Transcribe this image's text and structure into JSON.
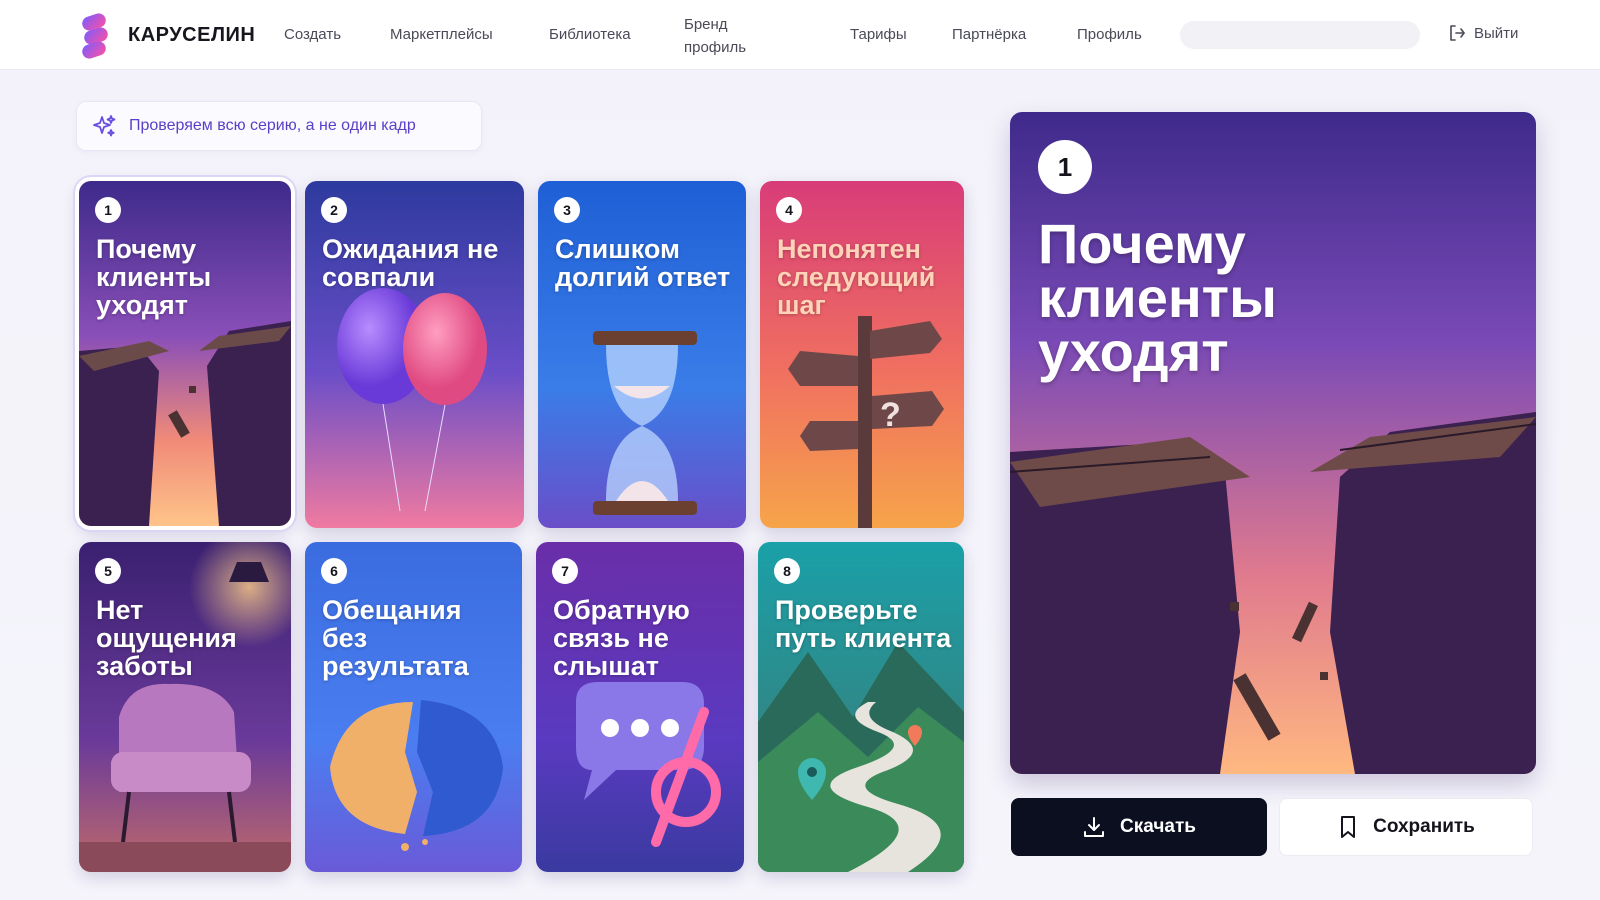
{
  "header": {
    "brand": "КАРУСЕЛИН",
    "nav": {
      "create": "Создать",
      "marketplaces": "Маркетплейсы",
      "library": "Библиотека",
      "brand_profile": "Бренд профиль",
      "tariffs": "Тарифы",
      "partner": "Партнёрка",
      "profile": "Профиль"
    },
    "search_value": "",
    "logout": "Выйти"
  },
  "pill": {
    "text": "Проверяем всю серию, а не один кадр",
    "icon": "sparkles-icon"
  },
  "cards": [
    {
      "number": "1",
      "title": "Почему клиенты уходят",
      "selected": true,
      "theme": "broken-bridge"
    },
    {
      "number": "2",
      "title": "Ожидания не совпали",
      "selected": false,
      "theme": "split-balloon"
    },
    {
      "number": "3",
      "title": "Слишком долгий ответ",
      "selected": false,
      "theme": "hourglass"
    },
    {
      "number": "4",
      "title": "Непонятен следующий шаг",
      "selected": false,
      "theme": "signpost"
    },
    {
      "number": "5",
      "title": "Нет ощущения заботы",
      "selected": false,
      "theme": "armchair-lamp"
    },
    {
      "number": "6",
      "title": "Обещания без результата",
      "selected": false,
      "theme": "broken-cookie"
    },
    {
      "number": "7",
      "title": "Обратную связь не слышат",
      "selected": false,
      "theme": "muted-chat-bubble"
    },
    {
      "number": "8",
      "title": "Проверьте путь клиента",
      "selected": false,
      "theme": "winding-road"
    }
  ],
  "preview": {
    "number": "1",
    "title": "Почему клиенты уходят"
  },
  "actions": {
    "download": "Скачать",
    "save": "Сохранить"
  },
  "colors": {
    "accent": "#5a3fc8",
    "dark_button": "#0c0f1f",
    "page_bg": "#f3f2fa"
  }
}
